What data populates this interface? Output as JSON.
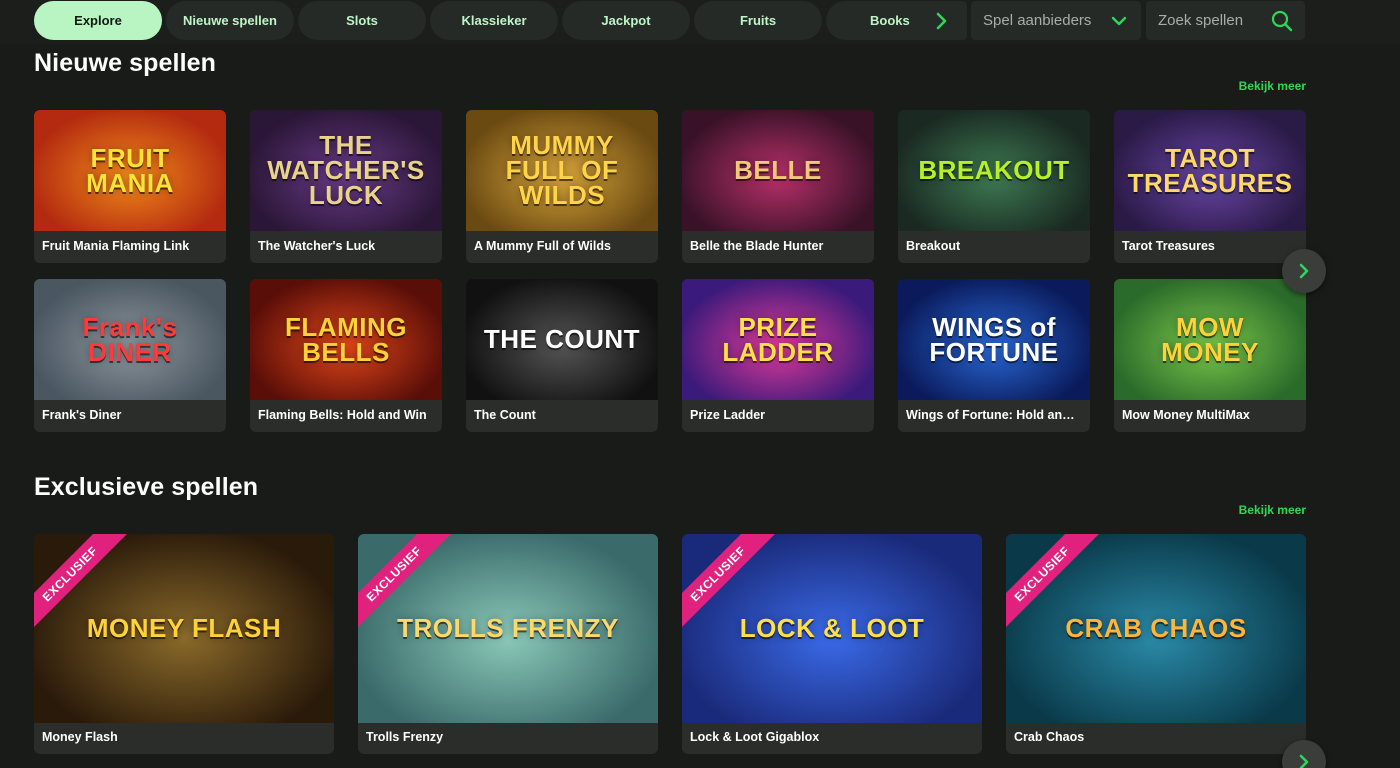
{
  "nav": {
    "categories": [
      "Explore",
      "Nieuwe spellen",
      "Slots",
      "Klassieker",
      "Jackpot",
      "Fruits",
      "Books"
    ],
    "provider_label": "Spel aanbieders",
    "search_placeholder": "Zoek spellen"
  },
  "new_games": {
    "title": "Nieuwe spellen",
    "view_more": "Bekijk meer",
    "games": [
      {
        "name": "Fruit Mania Flaming Link",
        "art": "FRUIT MANIA",
        "bg": "#b32a10",
        "bg2": "#f08a1a",
        "fg": "#ffe23a"
      },
      {
        "name": "The Watcher's Luck",
        "art": "THE WATCHER'S LUCK",
        "bg": "#2a1636",
        "bg2": "#6a3b8a",
        "fg": "#e9d38a"
      },
      {
        "name": "A Mummy Full of Wilds",
        "art": "MUMMY FULL OF WILDS",
        "bg": "#6b4a12",
        "bg2": "#d6a43a",
        "fg": "#ffd44a"
      },
      {
        "name": "Belle the Blade Hunter",
        "art": "BELLE",
        "bg": "#3a1228",
        "bg2": "#b8306a",
        "fg": "#f3c77a"
      },
      {
        "name": "Breakout",
        "art": "BREAKOUT",
        "bg": "#1a2a22",
        "bg2": "#3e7a52",
        "fg": "#b6f02a"
      },
      {
        "name": "Tarot Treasures",
        "art": "TAROT TREASURES",
        "bg": "#2a1a46",
        "bg2": "#6a46a8",
        "fg": "#ffd86a"
      },
      {
        "name": "Frank's Diner",
        "art": "Frank's DINER",
        "bg": "#4a5660",
        "bg2": "#8c969e",
        "fg": "#ff3a3a"
      },
      {
        "name": "Flaming Bells: Hold and Win",
        "art": "FLAMING BELLS",
        "bg": "#5a0e08",
        "bg2": "#e0461a",
        "fg": "#ffd23a"
      },
      {
        "name": "The Count",
        "art": "THE COUNT",
        "bg": "#111111",
        "bg2": "#555555",
        "fg": "#ffffff"
      },
      {
        "name": "Prize Ladder",
        "art": "PRIZE LADDER",
        "bg": "#3a1a7a",
        "bg2": "#e23a9a",
        "fg": "#ffe04a"
      },
      {
        "name": "Wings of Fortune: Hold and Win",
        "art": "WINGS of FORTUNE",
        "bg": "#0a1a5a",
        "bg2": "#2a6ad8",
        "fg": "#ffffff"
      },
      {
        "name": "Mow Money MultiMax",
        "art": "MOW MONEY",
        "bg": "#2a6a2a",
        "bg2": "#7ac84a",
        "fg": "#ffd23a"
      }
    ]
  },
  "exclusive_games": {
    "title": "Exclusieve spellen",
    "view_more": "Bekijk meer",
    "badge": "EXCLUSIEF",
    "games": [
      {
        "name": "Money Flash",
        "art": "MONEY FLASH",
        "bg": "#2a1a0a",
        "bg2": "#8a6a2a",
        "fg": "#ffd23a"
      },
      {
        "name": "Trolls Frenzy",
        "art": "TROLLS FRENZY",
        "bg": "#3a6a6a",
        "bg2": "#8ac8b8",
        "fg": "#ffd86a"
      },
      {
        "name": "Lock & Loot Gigablox",
        "art": "LOCK & LOOT",
        "bg": "#1a2a7a",
        "bg2": "#3a6ae8",
        "fg": "#ffe04a"
      },
      {
        "name": "Crab Chaos",
        "art": "CRAB CHAOS",
        "bg": "#0a3a4a",
        "bg2": "#2a8aa8",
        "fg": "#ffb43a"
      }
    ]
  }
}
